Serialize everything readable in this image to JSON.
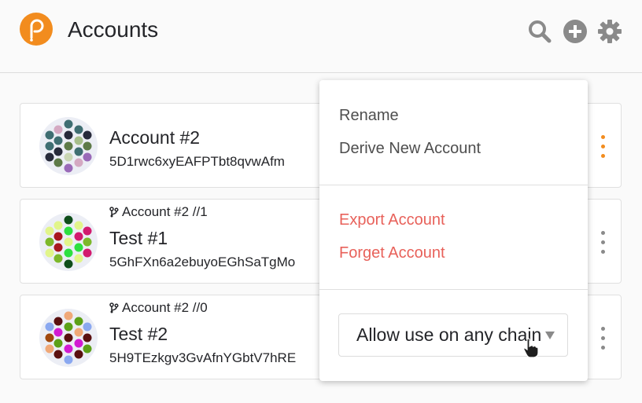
{
  "header": {
    "title": "Accounts",
    "icons": [
      "search-icon",
      "add-icon",
      "settings-icon"
    ]
  },
  "accounts": [
    {
      "name": "Account #2",
      "address": "5D1rwc6xyEAFPTbt8qvwAfm",
      "parent": "",
      "menu_color": "#f28c1e"
    },
    {
      "name": "Test #1",
      "address": "5GhFXn6a2ebuyoEGhSaTgMo",
      "parent": "Account #2 //1",
      "menu_color": "#8a8a8a"
    },
    {
      "name": "Test #2",
      "address": "5H9TEzkgv3GvAfnYGbtV7hRE",
      "parent": "Account #2 //0",
      "menu_color": "#8a8a8a"
    }
  ],
  "menu": {
    "rename": "Rename",
    "derive": "Derive New Account",
    "export": "Export Account",
    "forget": "Forget Account",
    "chain_select": "Allow use on any chain"
  },
  "colors": {
    "accent": "#f28c1e",
    "danger": "#e8615a",
    "icon_gray": "#8a8a8a"
  }
}
